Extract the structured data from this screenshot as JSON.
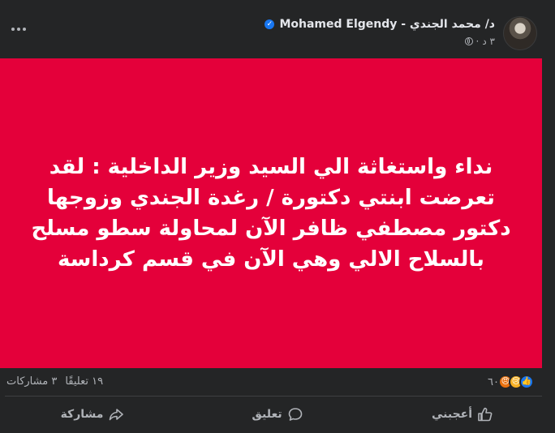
{
  "author": {
    "name": "د/ محمد الجندي - Mohamed Elgendy",
    "verified": true,
    "time": "٣ د"
  },
  "post": {
    "background_color": "#e4003a",
    "text": "نداء واستغاثة الي السيد وزير الداخلية : لقد تعرضت ابنتي دكتورة / رغدة الجندي وزوجها دكتور مصطفي ظافر الآن لمحاولة سطو مسلح بالسلاح الالي وهي الآن في قسم كرداسة"
  },
  "stats": {
    "reactions_count": "٦٠",
    "reaction_icons": [
      "like-icon",
      "sad-icon",
      "angry-icon"
    ],
    "comments": "١٩ تعليقًا",
    "shares": "٣ مشاركات"
  },
  "actions": {
    "like": "أعجبني",
    "comment": "تعليق",
    "share": "مشاركة"
  }
}
